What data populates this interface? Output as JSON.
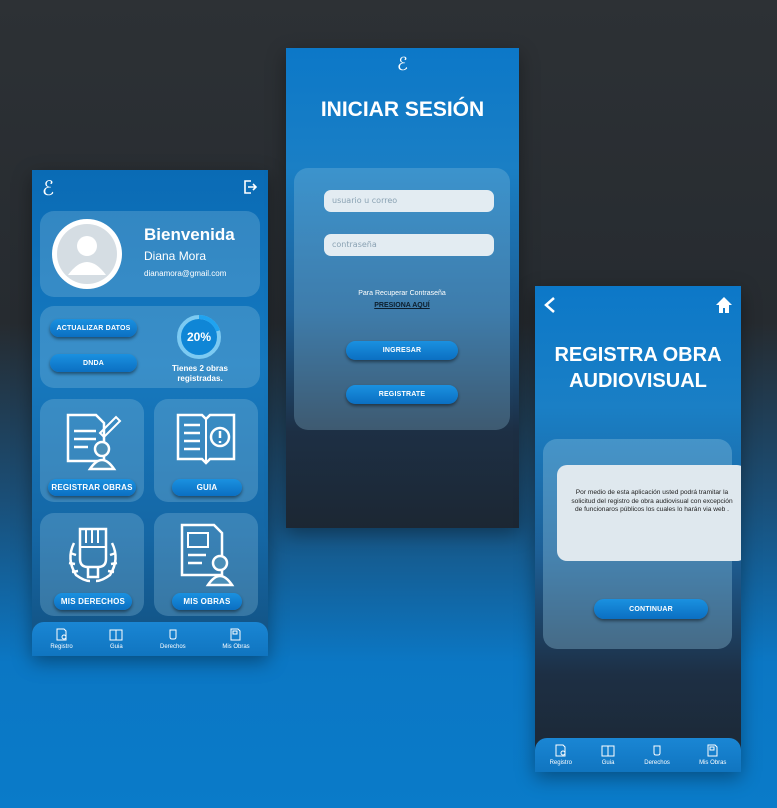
{
  "dashboard": {
    "logo": "ℰ",
    "greeting": "Bienvenida",
    "user_name": "Diana Mora",
    "email": "dianamora@gmail.com",
    "update_label": "ACTUALIZAR DATOS",
    "dnda_label": "DNDA",
    "progress_text": "20%",
    "progress_value": 0.2,
    "works_text_1": "Tienes 2 obras",
    "works_text_2": "registradas.",
    "tiles": [
      {
        "label": "REGISTRAR OBRAS",
        "icon": "document-person-icon"
      },
      {
        "label": "GUIA",
        "icon": "book-icon"
      },
      {
        "label": "MIS DERECHOS",
        "icon": "fist-laurel-icon"
      },
      {
        "label": "MIS OBRAS",
        "icon": "profile-document-icon"
      }
    ],
    "nav": [
      "Registro",
      "Guia",
      "Derechos",
      "Mis Obras"
    ]
  },
  "login": {
    "logo": "ℰ",
    "title": "INICIAR SESIÓN",
    "user_placeholder": "usuario u correo",
    "password_placeholder": "contraseña",
    "recover_text": "Para Recuperar Contraseña",
    "recover_link": "PRESIONA AQUÍ",
    "login_button": "INGRESAR",
    "register_button": "REGISTRATE"
  },
  "register": {
    "title_line1": "REGISTRA OBRA",
    "title_line2": "AUDIOVISUAL",
    "body": "Por medio de esta aplicación usted podrá tramitar la solicitud del registro de obra audiovisual con excepción de funcionaros públicos los cuales lo harán via web .",
    "continue_button": "CONTINUAR",
    "nav": [
      "Registro",
      "Guia",
      "Derechos",
      "Mis Obras"
    ]
  }
}
